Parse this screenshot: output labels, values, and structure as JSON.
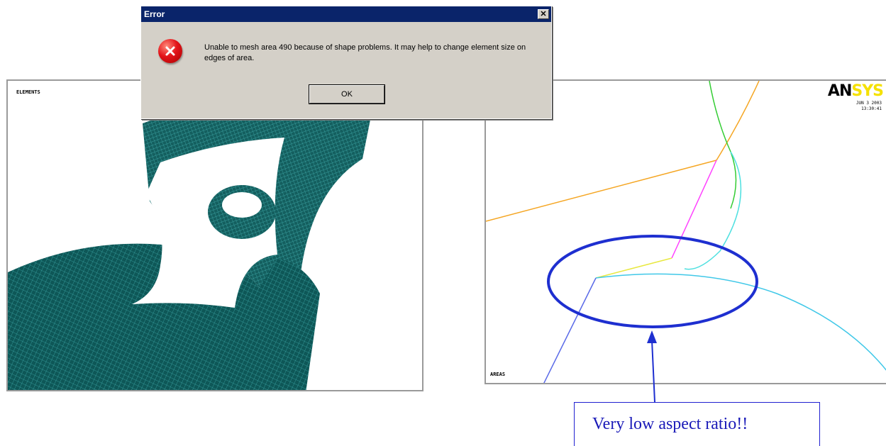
{
  "dialog": {
    "title": "Error",
    "close_glyph": "✕",
    "icon": "error-icon",
    "message": "Unable to mesh area 490 because of shape problems.  It may help to change element size on edges of area.",
    "ok_label": "OK"
  },
  "left_view": {
    "corner_label": "ELEMENTS"
  },
  "right_view": {
    "logo_an": "AN",
    "logo_sys": "SYS",
    "date_line1": "JUN  3 2003",
    "date_line2": "13:30:41",
    "area_label": "AREAS"
  },
  "callout": {
    "text": "Very low aspect ratio!!"
  },
  "colors": {
    "mesh": "#1a6a6a",
    "highlight_ellipse": "#1e2fd0",
    "arrow": "#1e2fd0"
  }
}
